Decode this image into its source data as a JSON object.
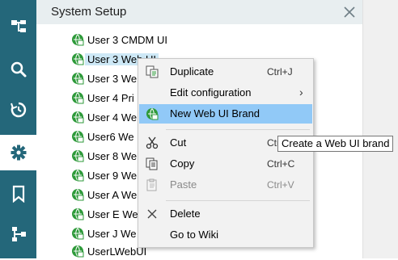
{
  "panel": {
    "title": "System Setup"
  },
  "rail": {
    "items": [
      {
        "icon": "hierarchy-icon",
        "active": false
      },
      {
        "icon": "search-icon",
        "active": false
      },
      {
        "icon": "history-icon",
        "active": false
      },
      {
        "icon": "gear-icon",
        "active": true
      },
      {
        "icon": "bookmark-icon",
        "active": false
      },
      {
        "icon": "workflow-icon",
        "active": false
      }
    ]
  },
  "tree": {
    "items": [
      {
        "label": "User 3 CMDM UI"
      },
      {
        "label": "User 3 Web UI"
      },
      {
        "label": "User 3 We"
      },
      {
        "label": "User 4 Pri"
      },
      {
        "label": "User 4 We"
      },
      {
        "label": "User6 We"
      },
      {
        "label": "User 8 We"
      },
      {
        "label": "User 9 We"
      },
      {
        "label": "User A We"
      },
      {
        "label": "User E We"
      },
      {
        "label": "User J We"
      },
      {
        "label": "UserLWebUI"
      }
    ]
  },
  "menu": {
    "items": [
      {
        "label": "Duplicate",
        "shortcut": "Ctrl+J",
        "icon": "duplicate-icon"
      },
      {
        "label": "Edit configuration",
        "shortcut": "",
        "icon": ""
      },
      {
        "label": "New Web UI Brand",
        "shortcut": "",
        "icon": "new-brand-icon"
      },
      {
        "label": "Cut",
        "shortcut": "Ctrl+X",
        "icon": "scissors-icon"
      },
      {
        "label": "Copy",
        "shortcut": "Ctrl+C",
        "icon": "copy-icon"
      },
      {
        "label": "Paste",
        "shortcut": "Ctrl+V",
        "icon": "paste-icon"
      },
      {
        "label": "Delete",
        "shortcut": "",
        "icon": "delete-icon"
      },
      {
        "label": "Go to Wiki",
        "shortcut": "",
        "icon": ""
      }
    ],
    "submenu_arrow": "›"
  },
  "tooltip": {
    "text": "Create a Web UI brand"
  },
  "colors": {
    "rail": "#24677a",
    "highlight": "#91c9f7",
    "selection": "#cde8f6",
    "tree_icon_green": "#2e9a3a"
  }
}
